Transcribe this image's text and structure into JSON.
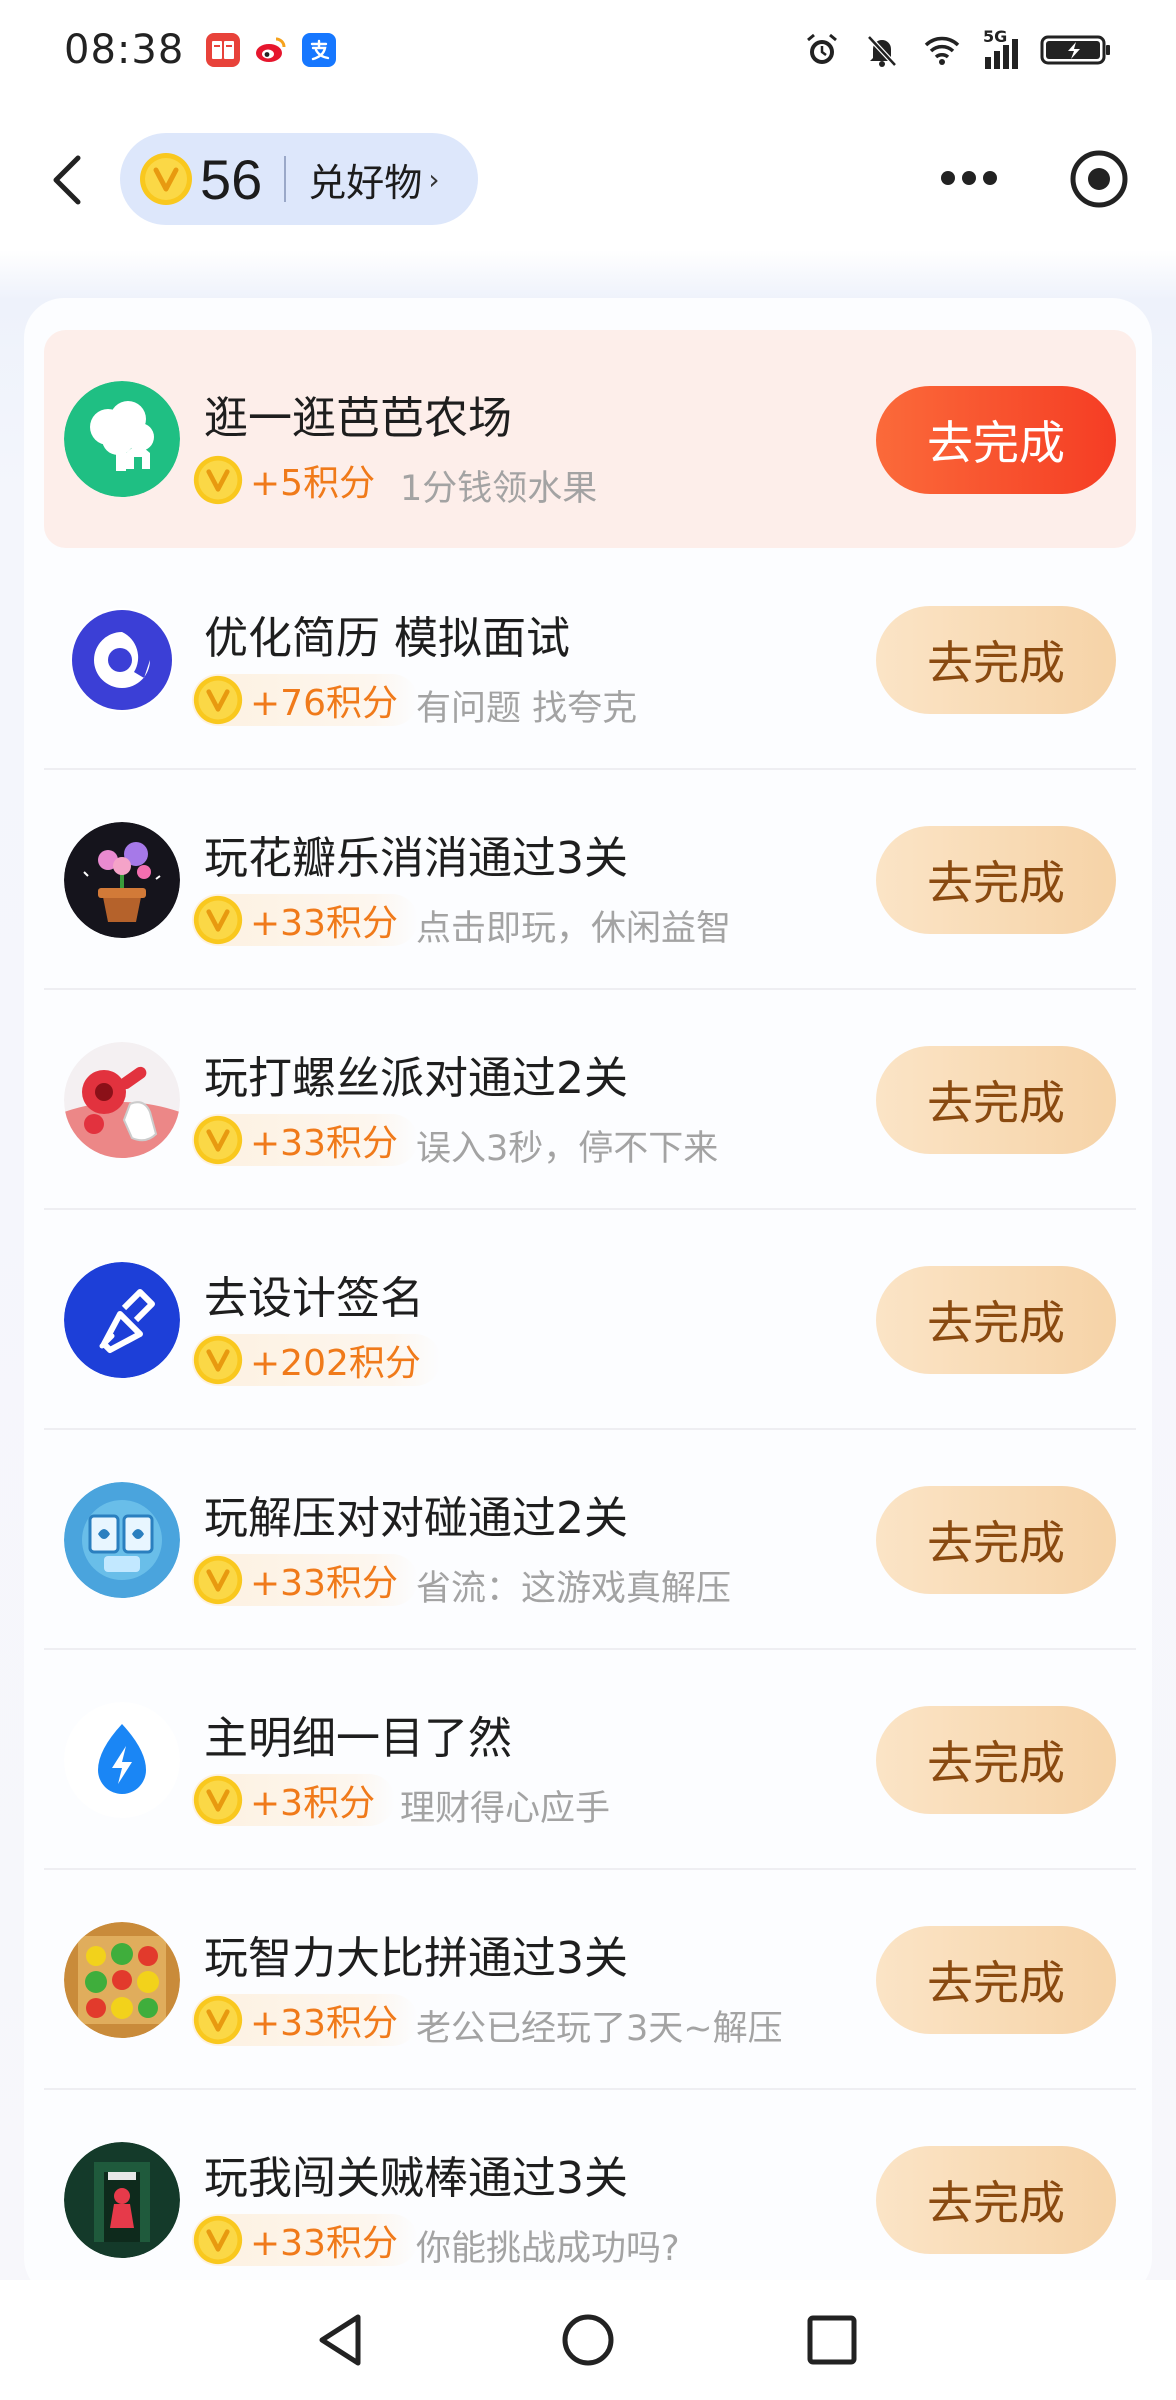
{
  "status_bar": {
    "time": "08:38",
    "apps": [
      {
        "name": "book-app-icon",
        "glyph": "📖",
        "color": "#e8423a"
      },
      {
        "name": "weibo-app-icon",
        "glyph": "微",
        "color": "#f6b21c"
      },
      {
        "name": "alipay-app-icon",
        "glyph": "支",
        "color": "#1677ff"
      }
    ],
    "network": "5G"
  },
  "header": {
    "points": "56",
    "redeem_label": "兑好物",
    "arrow": "›"
  },
  "tasks": [
    {
      "title": "逛一逛芭芭农场",
      "reward": "+5积分",
      "desc": "1分钱领水果",
      "button": "去完成",
      "highlight": true,
      "icon": "farm-tree-icon"
    },
    {
      "title": "优化简历 模拟面试",
      "reward": "+76积分",
      "desc": "有问题 找夸克",
      "button": "去完成",
      "highlight": false,
      "icon": "quark-logo-icon"
    },
    {
      "title": "玩花瓣乐消消通过3关",
      "reward": "+33积分",
      "desc": "点击即玩，休闲益智",
      "button": "去完成",
      "highlight": false,
      "icon": "flower-pot-game-icon"
    },
    {
      "title": "玩打螺丝派对通过2关",
      "reward": "+33积分",
      "desc": "误入3秒，停不下来",
      "button": "去完成",
      "highlight": false,
      "icon": "screw-game-icon"
    },
    {
      "title": "去设计签名",
      "reward": "+202积分",
      "desc": "",
      "button": "去完成",
      "highlight": false,
      "icon": "brush-icon"
    },
    {
      "title": "玩解压对对碰通过2关",
      "reward": "+33积分",
      "desc": "省流：这游戏真解压",
      "button": "去完成",
      "highlight": false,
      "icon": "tile-match-game-icon"
    },
    {
      "title": "主明细一目了然",
      "reward": "+3积分",
      "desc": "理财得心应手",
      "button": "去完成",
      "highlight": false,
      "icon": "lightning-drop-icon"
    },
    {
      "title": "玩智力大比拼通过3关",
      "reward": "+33积分",
      "desc": "老公已经玩了3天~解压",
      "button": "去完成",
      "highlight": false,
      "icon": "fruit-puzzle-game-icon"
    },
    {
      "title": "玩我闯关贼棒通过3关",
      "reward": "+33积分",
      "desc": "你能挑战成功吗?",
      "button": "去完成",
      "highlight": false,
      "icon": "escape-game-icon"
    }
  ],
  "colors": {
    "accent_orange": "#f07a1a",
    "primary_button": "#f5432a",
    "secondary_button": "#f8dbb6",
    "pill_bg": "#dde7fb"
  }
}
